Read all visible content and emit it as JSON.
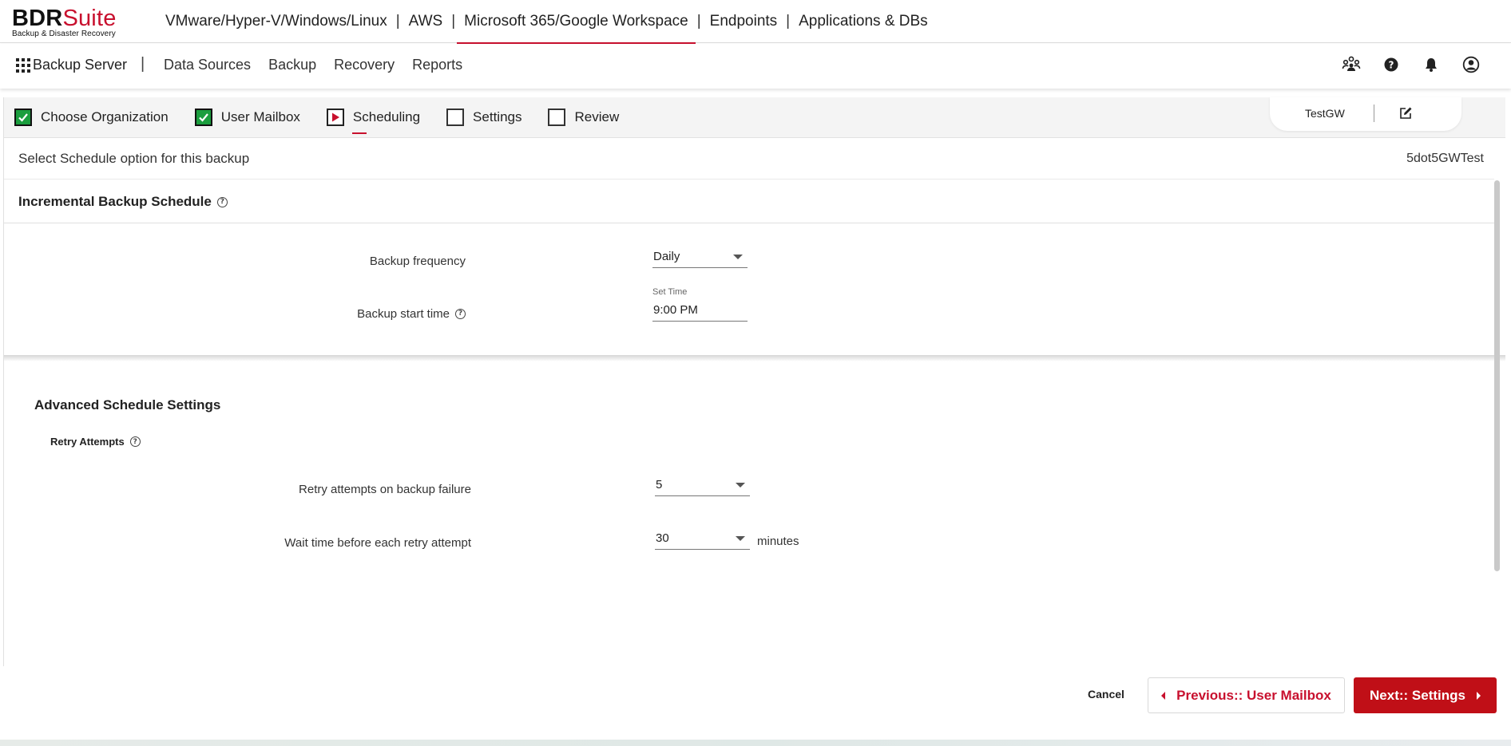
{
  "logo": {
    "bdr": "BDR",
    "suite": "Suite",
    "tagline": "Backup & Disaster Recovery"
  },
  "product_nav": {
    "items": [
      {
        "label": "VMware/Hyper-V/Windows/Linux"
      },
      {
        "label": "AWS"
      },
      {
        "label": "Microsoft 365/Google Workspace",
        "active": true
      },
      {
        "label": "Endpoints"
      },
      {
        "label": "Applications & DBs"
      }
    ],
    "separator": "|"
  },
  "secondary_nav": {
    "server": "Backup Server",
    "separator": "|",
    "links": [
      "Data Sources",
      "Backup",
      "Recovery",
      "Reports"
    ],
    "icons": [
      "users-icon",
      "help-icon",
      "bell-icon",
      "user-icon"
    ]
  },
  "stepper": {
    "steps": [
      {
        "label": "Choose Organization",
        "state": "done"
      },
      {
        "label": "User Mailbox",
        "state": "done"
      },
      {
        "label": "Scheduling",
        "state": "current"
      },
      {
        "label": "Settings",
        "state": "todo"
      },
      {
        "label": "Review",
        "state": "todo"
      }
    ],
    "job_name": "TestGW"
  },
  "page": {
    "subtitle": "Select Schedule option for this backup",
    "job_id": "5dot5GWTest"
  },
  "incremental": {
    "title": "Incremental Backup Schedule",
    "frequency_label": "Backup frequency",
    "frequency_value": "Daily",
    "start_time_label": "Backup start time",
    "start_time_float": "Set Time",
    "start_time_value": "9:00 PM"
  },
  "advanced": {
    "title": "Advanced Schedule Settings",
    "retry_heading": "Retry Attempts",
    "retry_label": "Retry attempts on backup failure",
    "retry_value": "5",
    "wait_label": "Wait time before each retry attempt",
    "wait_value": "30",
    "wait_units": "minutes"
  },
  "footer": {
    "cancel": "Cancel",
    "previous": "Previous:: User Mailbox",
    "next": "Next:: Settings"
  },
  "colors": {
    "accent": "#c8102e",
    "done": "#1b9e3e",
    "next_button": "#c00f17"
  }
}
